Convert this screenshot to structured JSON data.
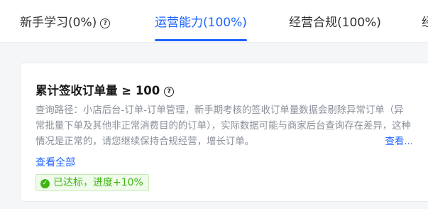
{
  "tabs": [
    {
      "label": "新手学习(0%)",
      "active": false
    },
    {
      "label": "运营能力(100%)",
      "active": true
    },
    {
      "label": "经营合规(100%)",
      "active": false
    },
    {
      "label": "经",
      "active": false
    }
  ],
  "card": {
    "title": "累计签收订单量 ≥ 100",
    "description": "查询路径：小店后台-订单-订单管理，新手期考核的签收订单量数据会剔除异常订单（异常批量下单及其他非正常消费目的的订单），实际数据可能与商家后台查询存在差异，这种情况是正常的，请您继续保持合规经营，增长订单。",
    "more_label": "查看...",
    "view_all_label": "查看全部",
    "status_badge": "已达标，进度+10%"
  },
  "colors": {
    "accent": "#1e64ff",
    "success": "#3eb511",
    "muted_text": "#8a8f99"
  },
  "icons": {
    "help": "question-circle-icon",
    "success": "check-circle-icon"
  }
}
